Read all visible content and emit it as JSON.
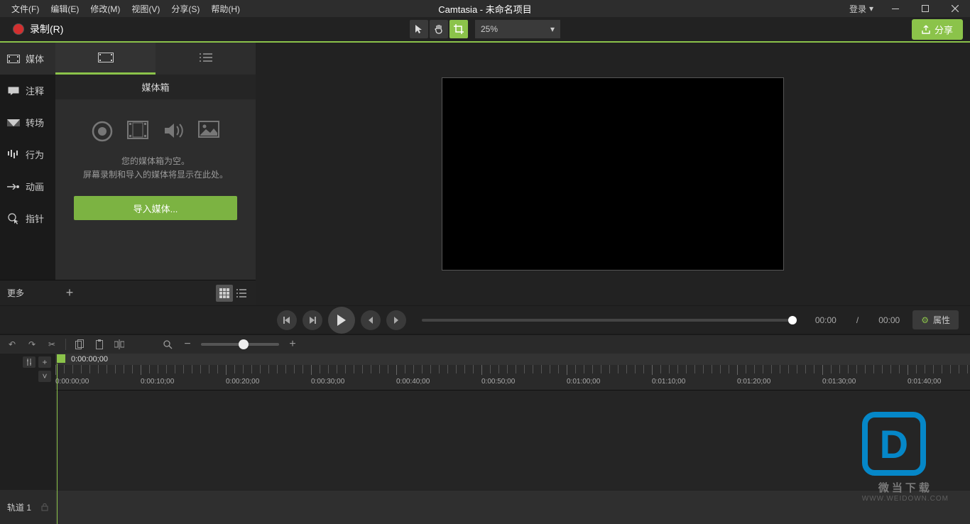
{
  "menu": {
    "file": "文件(F)",
    "edit": "编辑(E)",
    "modify": "修改(M)",
    "view": "视图(V)",
    "share": "分享(S)",
    "help": "帮助(H)"
  },
  "title": "Camtasia - 未命名项目",
  "login": "登录",
  "record": "录制(R)",
  "zoom": "25%",
  "shareBtn": "分享",
  "sideTabs": {
    "media": "媒体",
    "annot": "注释",
    "trans": "转场",
    "behav": "行为",
    "anim": "动画",
    "cursor": "指针",
    "more": "更多"
  },
  "panel": {
    "title": "媒体箱",
    "empty1": "您的媒体箱为空。",
    "empty2": "屏幕录制和导入的媒体将显示在此处。",
    "import": "导入媒体..."
  },
  "playback": {
    "current": "00:00",
    "sep": "/",
    "total": "00:00"
  },
  "props": "属性",
  "timeline": {
    "playhead": "0:00:00;00",
    "ticks": [
      "0:00:00;00",
      "0:00:10;00",
      "0:00:20;00",
      "0:00:30;00",
      "0:00:40;00",
      "0:00:50;00",
      "0:01:00;00",
      "0:01:10;00",
      "0:01:20;00",
      "0:01:30;00",
      "0:01:40;00"
    ],
    "track1": "轨道 1"
  },
  "watermark": {
    "text": "微当下载",
    "url": "WWW.WEIDOWN.COM"
  }
}
